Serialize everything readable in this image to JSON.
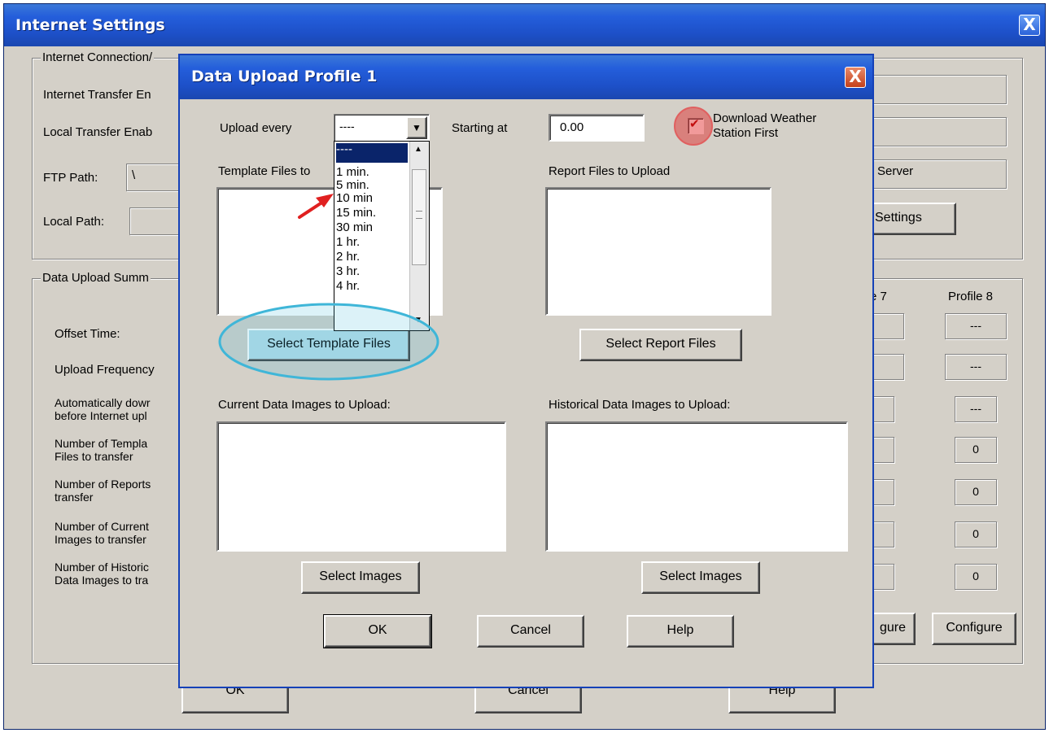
{
  "outer": {
    "title": "Internet Settings",
    "close_label": "X",
    "connection_group": "Internet Connection/",
    "internet_transfer_label": "Internet Transfer En",
    "local_transfer_label": "Local Transfer Enab",
    "ftp_path_label": "FTP Path:",
    "ftp_path_value": "\\",
    "local_path_label": "Local Path:",
    "server_label": "Server",
    "settings_button": "Settings",
    "summary_group": "Data Upload Summ",
    "profile7_header": "e 7",
    "profile8_header": "Profile 8",
    "rows": [
      {
        "label": "Offset Time:"
      },
      {
        "label": "Upload Frequency"
      },
      {
        "label": "Automatically dowr\nbefore Internet upl"
      },
      {
        "label": "Number of Templa\nFiles to transfer"
      },
      {
        "label": "Number of Reports\ntransfer"
      },
      {
        "label": "Number of Current\nImages to transfer"
      },
      {
        "label": "Number of Historic\nData Images to tra"
      }
    ],
    "profile8_values": [
      "---",
      "---",
      "---",
      "0",
      "0",
      "0",
      "0"
    ],
    "configure7": "gure",
    "configure8": "Configure",
    "bottom_ok": "OK",
    "bottom_cancel": "Cancel",
    "bottom_help": "Help"
  },
  "dialog": {
    "title": "Data Upload Profile 1",
    "close_label": "X",
    "upload_every_label": "Upload every",
    "upload_every_value": "----",
    "starting_at_label": "Starting at",
    "starting_at_value": "0.00",
    "download_checkbox_label": "Download Weather Station First",
    "download_checkbox_line1": "Download Weather",
    "download_checkbox_line2": "Station First",
    "template_files_label": "Template Files to",
    "report_files_label": "Report Files to Upload",
    "select_template_button": "Select Template Files",
    "select_report_button": "Select Report Files",
    "current_images_label": "Current Data Images to Upload:",
    "historical_images_label": "Historical Data Images to Upload:",
    "select_images_left": "Select Images",
    "select_images_right": "Select Images",
    "ok_button": "OK",
    "cancel_button": "Cancel",
    "help_button": "Help"
  },
  "dropdown_options": [
    "----",
    "1 min.",
    "5 min.",
    "10 min",
    "15 min.",
    "30 min",
    "1 hr.",
    "2 hr.",
    "3 hr.",
    "4 hr."
  ],
  "colors": {
    "title_blue": "#245edb",
    "annotation_red": "#e02020",
    "annotation_cyan": "#3fb6d8"
  }
}
